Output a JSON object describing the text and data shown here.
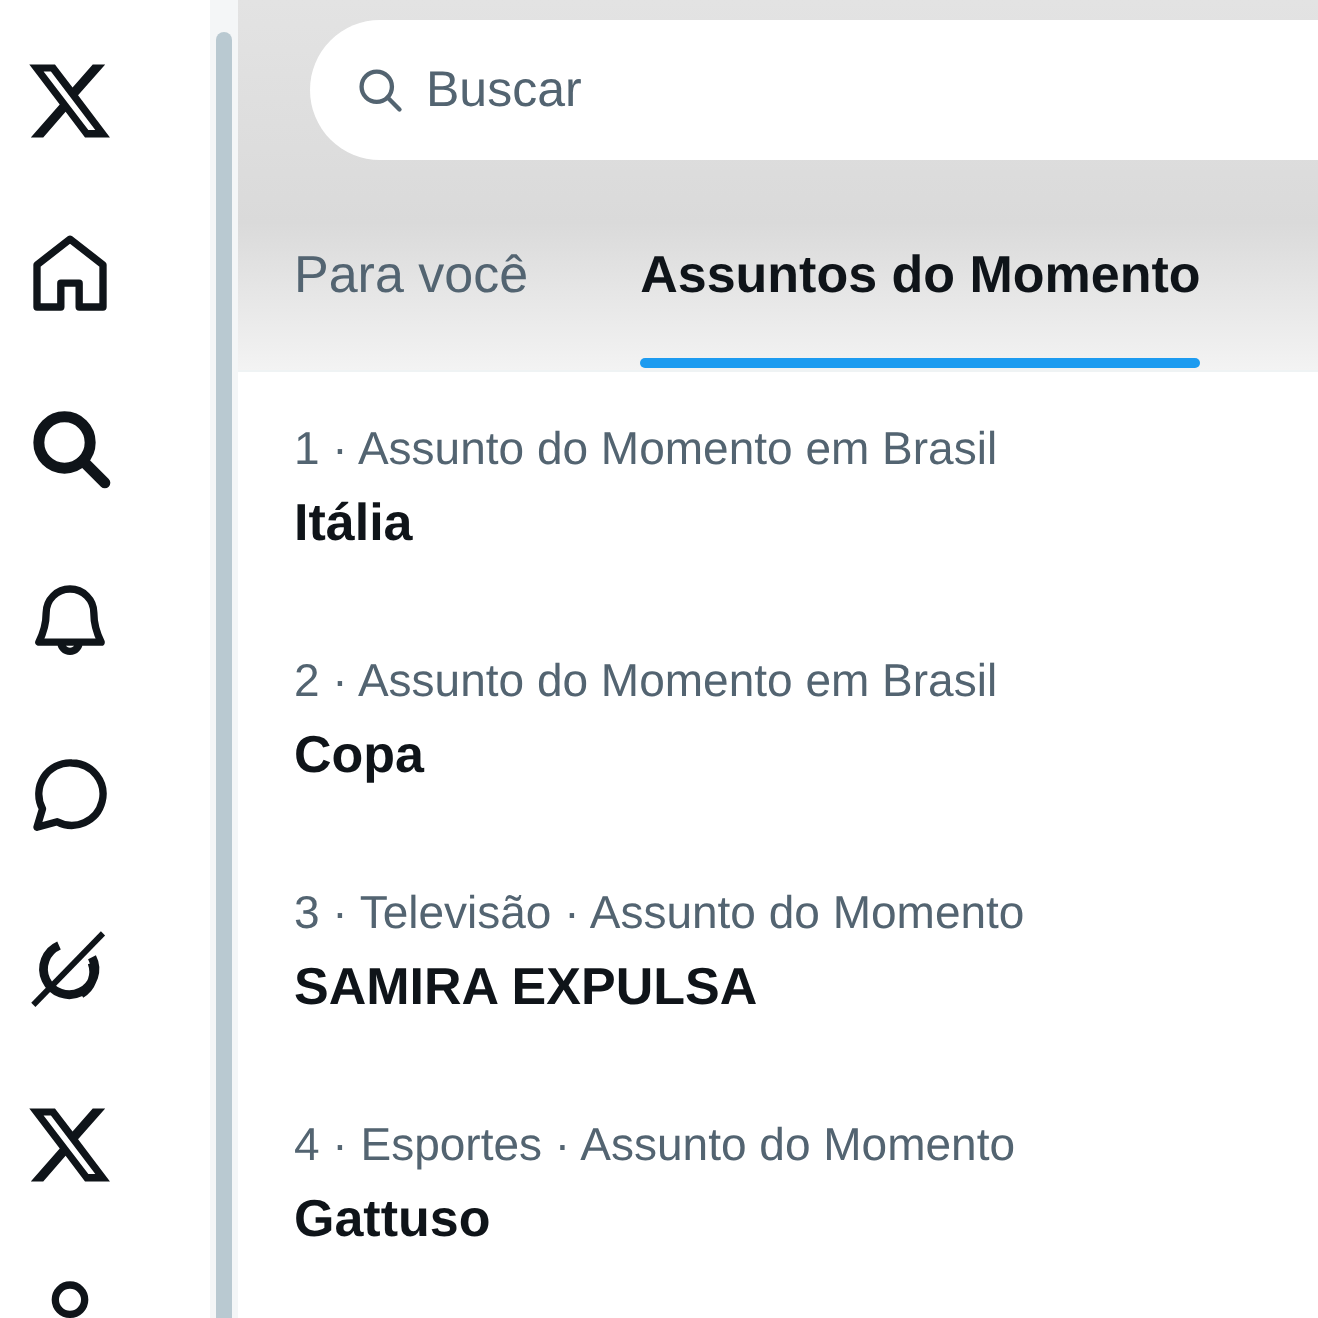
{
  "sidebar": {
    "items": [
      {
        "kind": "logo"
      },
      {
        "kind": "home"
      },
      {
        "kind": "search"
      },
      {
        "kind": "bell"
      },
      {
        "kind": "chat"
      },
      {
        "kind": "grok"
      },
      {
        "kind": "logo"
      },
      {
        "kind": "person"
      }
    ]
  },
  "search": {
    "placeholder": "Buscar"
  },
  "tabs": [
    {
      "label": "Para você",
      "selected": false
    },
    {
      "label": "Assuntos do Momento",
      "selected": true
    }
  ],
  "trends": [
    {
      "meta": "1 · Assunto do Momento em Brasil",
      "title": "Itália"
    },
    {
      "meta": "2 · Assunto do Momento em Brasil",
      "title": "Copa"
    },
    {
      "meta": "3 · Televisão · Assunto do Momento",
      "title": "SAMIRA EXPULSA"
    },
    {
      "meta": "4 · Esportes · Assunto do Momento",
      "title": "Gattuso"
    }
  ]
}
